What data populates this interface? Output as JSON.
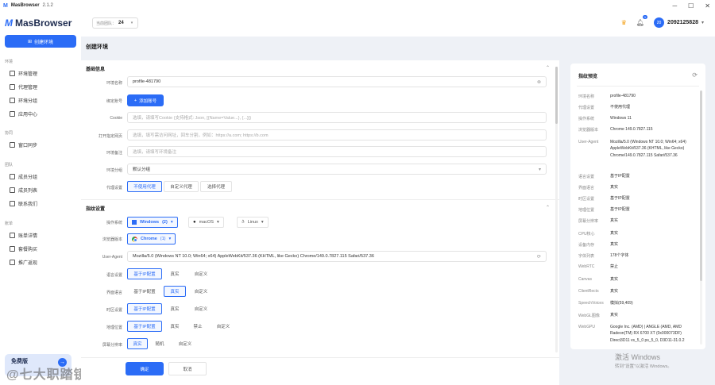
{
  "app": {
    "title": "MasBrowser",
    "version": "2.1.2"
  },
  "window_controls": [
    "─",
    "☐",
    "✕"
  ],
  "sidebar": {
    "brand": "MasBrowser",
    "create_button": "创建环境",
    "groups": [
      {
        "label": "环境",
        "items": [
          "环境管理",
          "代理管理",
          "环境分组",
          "应用中心"
        ]
      },
      {
        "label": "协同",
        "items": [
          "窗口同步"
        ]
      },
      {
        "label": "团队",
        "items": [
          "成员分组",
          "成员列表",
          "联系我们"
        ]
      },
      {
        "label": "账单",
        "items": [
          "账单详情",
          "套餐购买",
          "推广返现"
        ]
      }
    ],
    "free_card": "免费版",
    "watermark": "@七大职踏镜"
  },
  "topbar": {
    "team_label": "当前团队：",
    "team_value": "24",
    "notify_badge": "1",
    "avatar": "20",
    "username": "2092125828"
  },
  "page_title": "创建环境",
  "basic": {
    "title": "基础信息",
    "env_name_label": "环境名称",
    "env_name_value": "profile-481790",
    "account_label": "绑定账号",
    "add_account_btn": "添加账号",
    "cookie_label": "Cookie",
    "cookie_placeholder": "选填，请填写Cookie (支持格式: Json, [{Name=Value...}, {...}])",
    "open_url_label": "打开指定网页",
    "open_url_placeholder": "选填，填写需访问网址，回车分割，例如：https://a.com; https://b.com",
    "remark_label": "环境备注",
    "remark_placeholder": "选填，请填写环境备注",
    "group_label": "环境分组",
    "group_value": "默认分组",
    "proxy_label": "代理设置",
    "proxy_options": [
      "不使用代理",
      "自定义代理",
      "选择代理"
    ]
  },
  "fingerprint": {
    "title": "指纹设置",
    "os_label": "操作系统",
    "os_options": [
      "Windows",
      "macOS",
      "Linux"
    ],
    "os_windows_count": "(2)",
    "browser_label": "浏览器版本",
    "browser_value": "Chrome",
    "browser_count": "(1)",
    "ua_label": "User-Agent",
    "ua_value": "Mozilla/5.0 (Windows NT 10.0; Win64; x64) AppleWebKit/537.36 (KHTML, like Gecko) Chrome/149.0.7827.115 Safari/537.36",
    "language_label": "语言设置",
    "language_options": [
      "基于IP配置",
      "真实",
      "自定义"
    ],
    "ui_lang_label": "界面语言",
    "ui_lang_options": [
      "基于IP配置",
      "真实",
      "自定义"
    ],
    "timezone_label": "时区设置",
    "timezone_options": [
      "基于IP配置",
      "真实",
      "自定义"
    ],
    "geo_label": "地理位置",
    "geo_options": [
      "基于IP配置",
      "真实",
      "禁止",
      "自定义"
    ],
    "resolution_label": "屏幕分辨率",
    "resolution_options": [
      "真实",
      "随机",
      "自定义"
    ]
  },
  "footer": {
    "confirm": "确定",
    "cancel": "取消"
  },
  "preview": {
    "title": "指纹预览",
    "rows": [
      {
        "k": "环境名称",
        "v": "profile-481790"
      },
      {
        "k": "代理设置",
        "v": "不使用代理"
      },
      {
        "k": "操作系统",
        "v": "Windows 11"
      },
      {
        "k": "浏览器版本",
        "v": "Chrome 149.0.7827.115"
      },
      {
        "k": "User-Agent",
        "v": "Mozilla/5.0 (Windows NT 10.0; Win64; x64) AppleWebKit/537.36 (KHTML, like Gecko) Chrome/149.0.7827.115 Safari/537.36"
      },
      {
        "k": "语言设置",
        "v": "基于IP配置"
      },
      {
        "k": "界面语言",
        "v": "真实"
      },
      {
        "k": "时区设置",
        "v": "基于IP配置"
      },
      {
        "k": "地理位置",
        "v": "基于IP配置"
      },
      {
        "k": "屏幕分辨率",
        "v": "真实"
      },
      {
        "k": "CPU核心",
        "v": "真实"
      },
      {
        "k": "设备内存",
        "v": "真实"
      },
      {
        "k": "字体列表",
        "v": "178个字体"
      },
      {
        "k": "WebRTC",
        "v": "禁止"
      },
      {
        "k": "Canvas",
        "v": "真实"
      },
      {
        "k": "ClientRects",
        "v": "真实"
      },
      {
        "k": "SpeechVoices",
        "v": "模拟(59,409)"
      },
      {
        "k": "WebGL图像",
        "v": "真实"
      },
      {
        "k": "WebGPU",
        "v": "Google Inc. (AMD) | ANGLE (AMD, AMD Radeon(TM) RX 6700 XT (0x000073DF) Direct3D11 vs_5_0 ps_5_0, D3D11-31.0.2"
      }
    ]
  },
  "activation": {
    "line1": "激活 Windows",
    "line2": "转到\"设置\"以激活 Windows。"
  },
  "colors": {
    "accent": "#2b6cf6"
  }
}
